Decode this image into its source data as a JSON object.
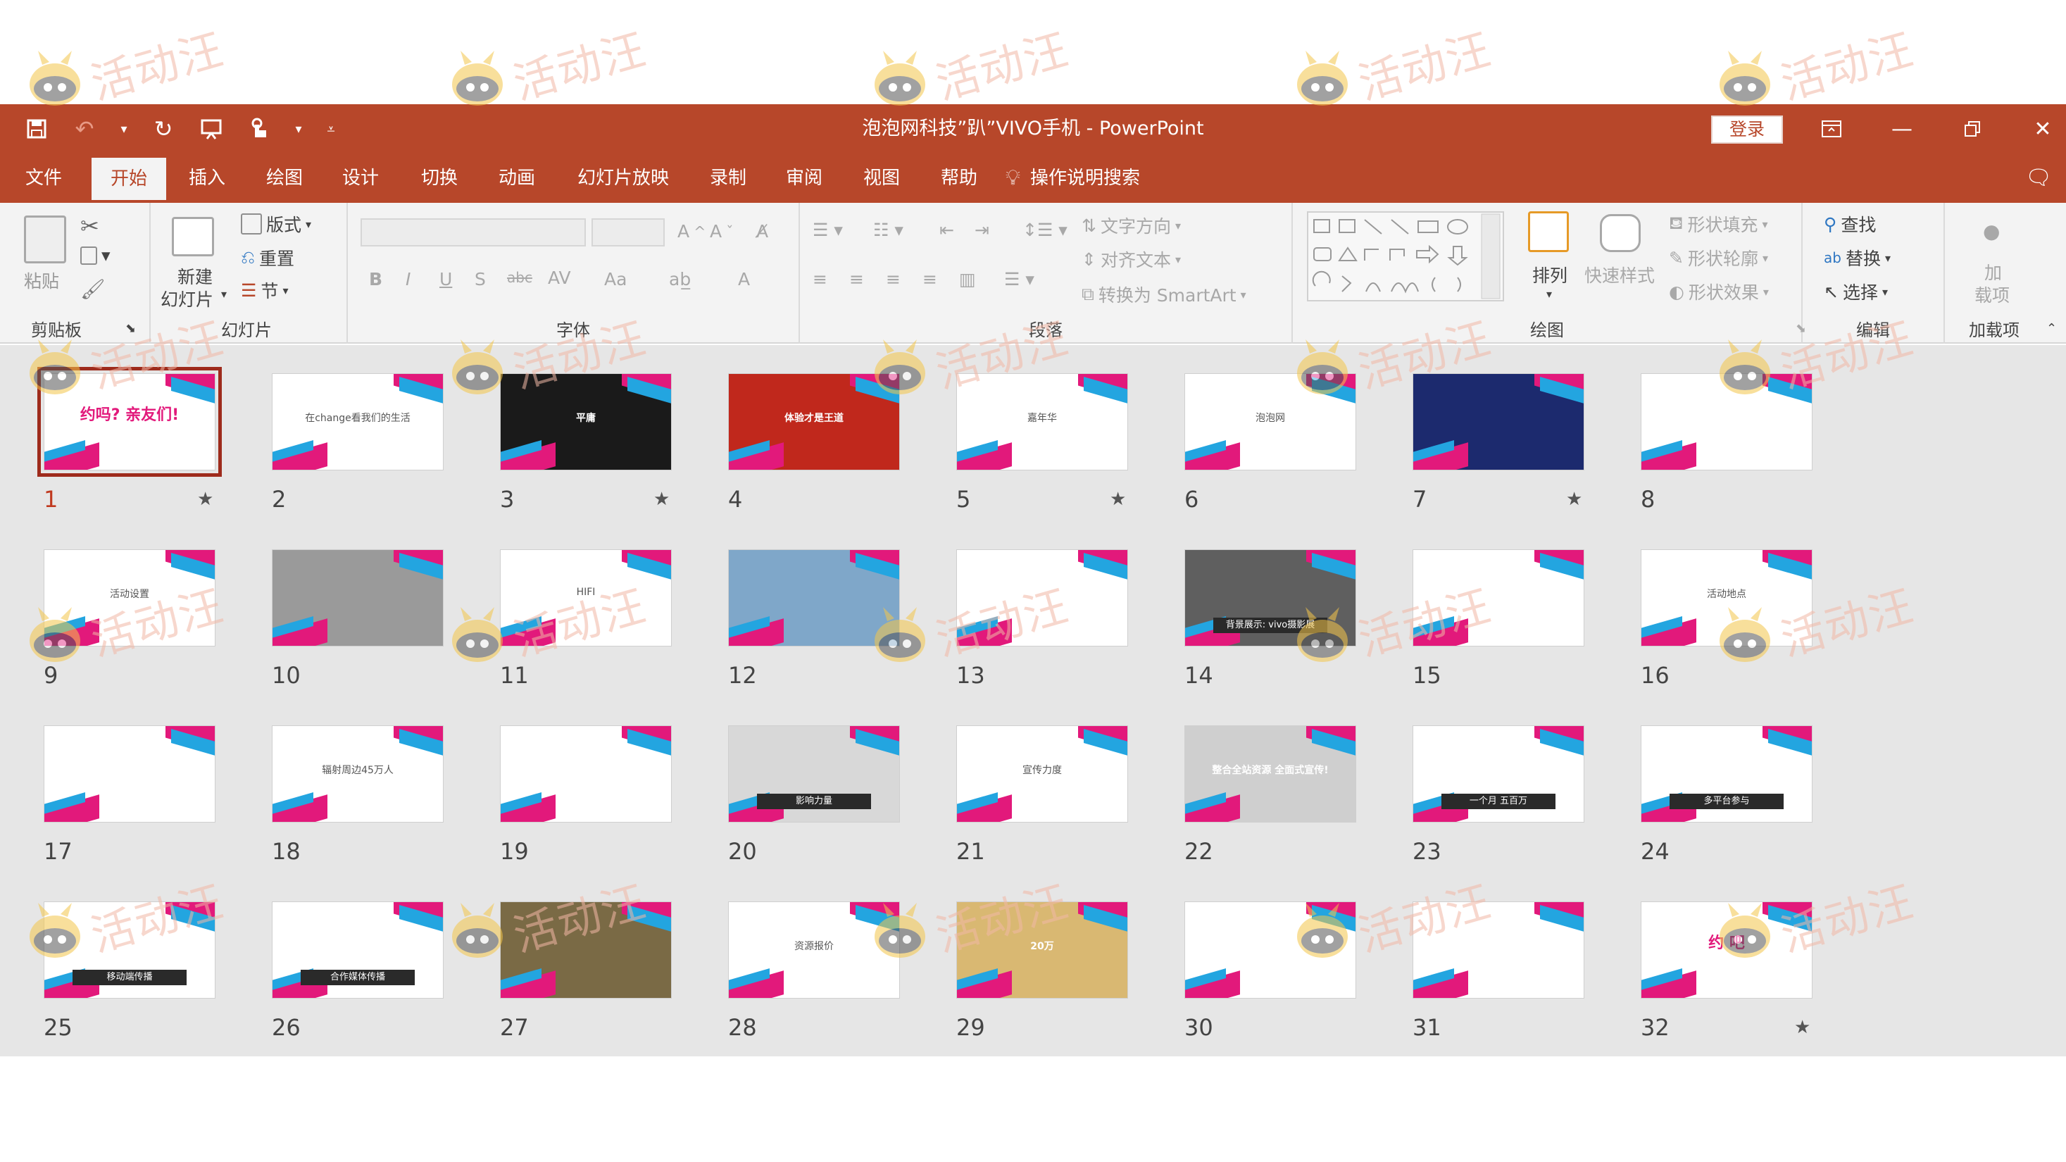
{
  "window": {
    "title": "泡泡网科技”趴”VIVO手机  -  PowerPoint",
    "login_label": "登录",
    "accent": "#b7472a"
  },
  "tabs": [
    {
      "label": "文件"
    },
    {
      "label": "开始",
      "active": true
    },
    {
      "label": "插入"
    },
    {
      "label": "绘图"
    },
    {
      "label": "设计"
    },
    {
      "label": "切换"
    },
    {
      "label": "动画"
    },
    {
      "label": "幻灯片放映"
    },
    {
      "label": "录制"
    },
    {
      "label": "审阅"
    },
    {
      "label": "视图"
    },
    {
      "label": "帮助"
    }
  ],
  "tell_me": "操作说明搜索",
  "ribbon": {
    "clipboard": {
      "label": "剪贴板",
      "paste": "粘贴"
    },
    "slides": {
      "label": "幻灯片",
      "new_slide_line1": "新建",
      "new_slide_line2": "幻灯片",
      "layout": "版式",
      "reset": "重置",
      "section": "节"
    },
    "font": {
      "label": "字体",
      "buttons": [
        "B",
        "I",
        "U",
        "S",
        "abc",
        "AV",
        "Aa",
        "A"
      ]
    },
    "paragraph": {
      "label": "段落",
      "text_direction": "文字方向",
      "align_text": "对齐文本",
      "smartart": "转换为 SmartArt"
    },
    "drawing": {
      "label": "绘图",
      "arrange": "排列",
      "quick_styles": "快速样式",
      "shape_fill": "形状填充",
      "shape_outline": "形状轮廓",
      "shape_effects": "形状效果"
    },
    "editing": {
      "label": "编辑",
      "find": "查找",
      "replace": "替换",
      "select": "选择"
    },
    "addins": {
      "label": "加载项",
      "line1": "加",
      "line2": "载项"
    }
  },
  "slides": [
    {
      "n": "1",
      "star": true,
      "text": "约吗? 亲友们!",
      "selected": true
    },
    {
      "n": "2",
      "text": "在change看我们的生活"
    },
    {
      "n": "3",
      "star": true,
      "text": "平庸"
    },
    {
      "n": "4",
      "text": "体验才是王道"
    },
    {
      "n": "5",
      "star": true,
      "text": "嘉年华"
    },
    {
      "n": "6",
      "text": "泡泡网"
    },
    {
      "n": "7",
      "star": true,
      "text": ""
    },
    {
      "n": "8",
      "text": ""
    },
    {
      "n": "9",
      "text": "活动设置"
    },
    {
      "n": "10",
      "text": ""
    },
    {
      "n": "11",
      "text": "HIFI"
    },
    {
      "n": "12",
      "text": ""
    },
    {
      "n": "13",
      "text": ""
    },
    {
      "n": "14",
      "text": "背景展示: vivo摄影展"
    },
    {
      "n": "15",
      "text": ""
    },
    {
      "n": "16",
      "text": "活动地点"
    },
    {
      "n": "17",
      "text": ""
    },
    {
      "n": "18",
      "text": "辐射周边45万人"
    },
    {
      "n": "19",
      "text": ""
    },
    {
      "n": "20",
      "text": "影响力量"
    },
    {
      "n": "21",
      "text": "宣传力度"
    },
    {
      "n": "22",
      "text": "整合全站资源 全面式宣传!"
    },
    {
      "n": "23",
      "text": "一个月     五百万"
    },
    {
      "n": "24",
      "text": "多平台参与"
    },
    {
      "n": "25",
      "text": "移动端传播"
    },
    {
      "n": "26",
      "text": "合作媒体传播"
    },
    {
      "n": "27",
      "text": ""
    },
    {
      "n": "28",
      "text": "资源报价"
    },
    {
      "n": "29",
      "text": "20万"
    },
    {
      "n": "30",
      "text": ""
    },
    {
      "n": "31",
      "text": ""
    },
    {
      "n": "32",
      "star": true,
      "text": "约 吧"
    }
  ],
  "watermark": "活动汪"
}
